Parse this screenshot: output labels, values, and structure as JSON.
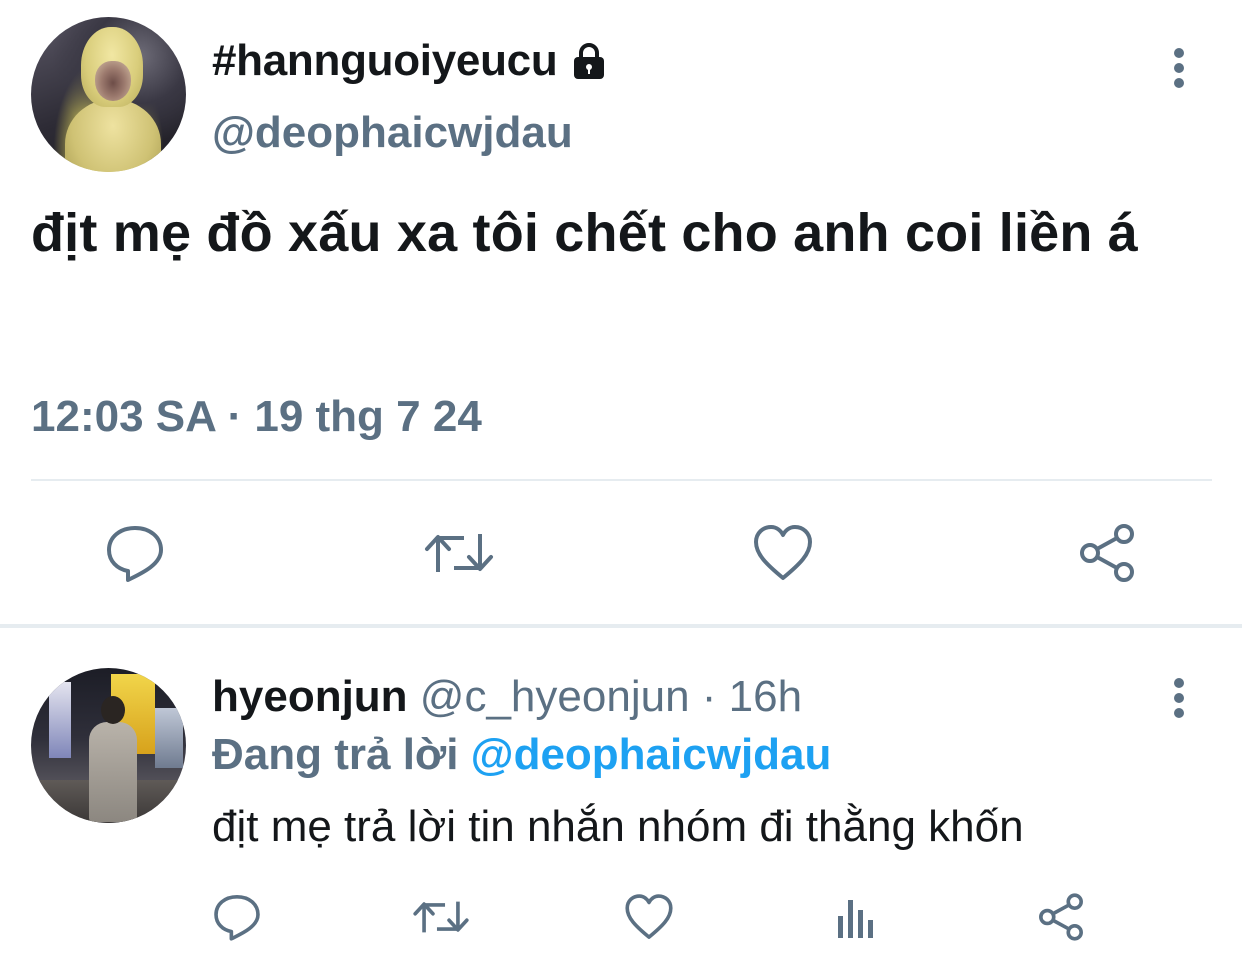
{
  "main_tweet": {
    "display_name": "#hannguoiyeucu",
    "handle": "@deophaicwjdau",
    "text": "địt mẹ đồ xấu xa tôi chết cho anh coi liền á",
    "timestamp": "12:03 SA · 19 thg 7 24",
    "icons": {
      "lock": "lock-icon",
      "more": "more-vertical-icon",
      "reply": "reply-icon",
      "retweet": "retweet-icon",
      "like": "heart-icon",
      "share": "share-icon"
    }
  },
  "reply_tweet": {
    "display_name": "hyeonjun",
    "handle": "@c_hyeonjun",
    "separator": " · ",
    "time_ago": "16h",
    "replying_label": "Đang trả lời",
    "replying_handle": "@deophaicwjdau",
    "text": "địt mẹ trả lời tin nhắn nhóm đi thằng khốn",
    "icons": {
      "more": "more-vertical-icon",
      "reply": "reply-icon",
      "retweet": "retweet-icon",
      "like": "heart-icon",
      "views": "views-icon",
      "share": "share-icon"
    }
  },
  "colors": {
    "text_primary": "#14171a",
    "text_secondary": "#5b7083",
    "link": "#1da1f2",
    "divider": "#e6ecf0",
    "icon": "#5b7083"
  }
}
